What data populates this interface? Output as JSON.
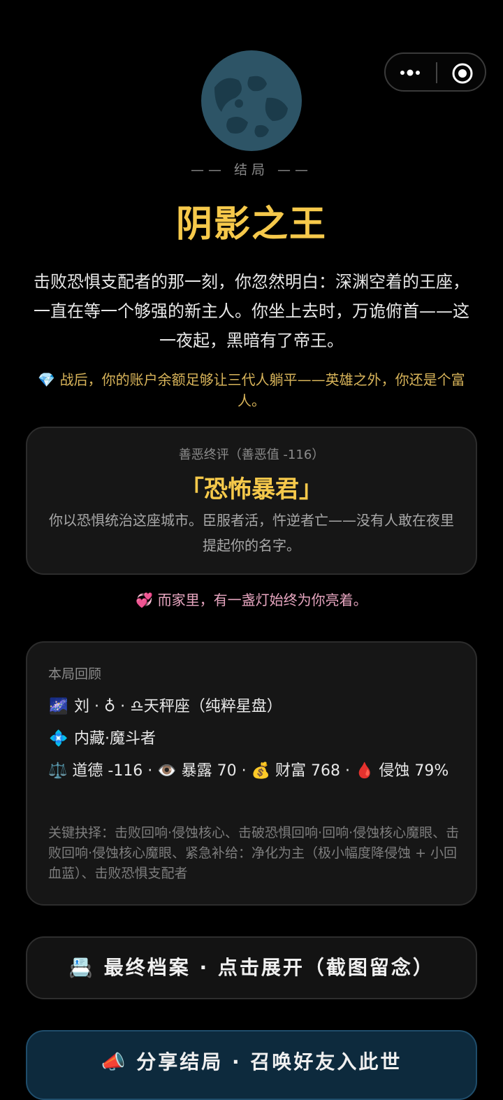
{
  "capsule": {
    "more_icon": "more-dots-icon",
    "close_icon": "target-close-icon"
  },
  "ending": {
    "tag": "—— 结局 ——",
    "title": "阴影之王",
    "story": "击败恐惧支配者的那一刻，你忽然明白：深渊空着的王座，一直在等一个够强的新主人。你坐上去时，万诡俯首——这一夜起，黑暗有了帝王。",
    "wealth_icon": "💎",
    "wealth_note": "战后，你的账户余额足够让三代人躺平——英雄之外，你还是个富人。"
  },
  "verdict": {
    "subtitle": "善恶终评（善恶值 -116）",
    "name": "「恐怖暴君」",
    "description": "你以恐惧统治这座城市。臣服者活，忤逆者亡——没有人敢在夜里提起你的名字。"
  },
  "home_note": {
    "icon": "💞",
    "text": "而家里，有一盏灯始终为你亮着。"
  },
  "recap": {
    "heading": "本局回顾",
    "identity": "刘 · ♁ · ♎天秤座（纯粹星盘）",
    "identity_icon": "🌌",
    "talent_icon": "💠",
    "talent": "内藏·魔斗者",
    "stats": "⚖️ 道德 -116 · 👁️ 暴露 70 · 💰 财富 768 · 🩸 侵蚀 79%",
    "choices": "关键抉择：击败回响·侵蚀核心、击破恐惧回响·回响·侵蚀核心魔眼、击败回响·侵蚀核心魔眼、紧急补给：净化为主（极小幅度降侵蚀 + 小回血蓝）、击败恐惧支配者"
  },
  "buttons": {
    "archive": "📇 最终档案 · 点击展开（截图留念）",
    "share": "📣 分享结局 · 召唤好友入此世"
  },
  "colors": {
    "gold": "#f6c94b",
    "pink": "#e7a6c0",
    "share_bg": "#0d2a3d"
  }
}
